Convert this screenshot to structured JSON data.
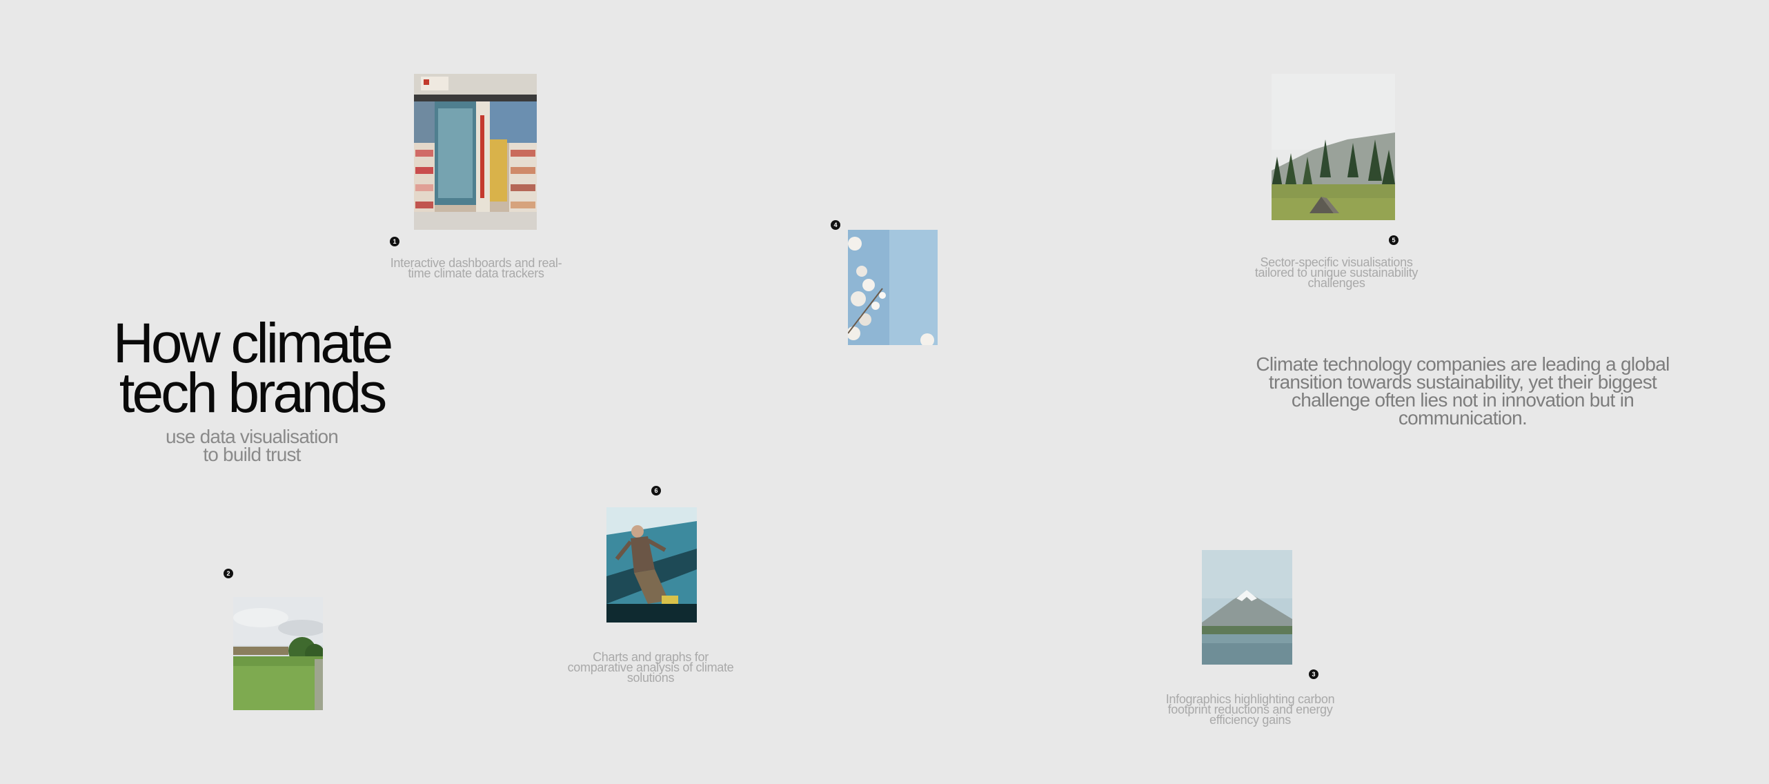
{
  "hero": {
    "title_line1": "How climate",
    "title_line2": "tech brands",
    "subtitle_line1": "use data visualisation",
    "subtitle_line2": "to build trust"
  },
  "intro": "Climate technology companies are leading a global transition towards sustainability, yet their biggest challenge often lies not in innovation but in communication.",
  "items": [
    {
      "number": "1",
      "caption_line1": "Interactive dashboards and real-",
      "caption_line2": "time climate data trackers",
      "image": "storefront-photo"
    },
    {
      "number": "2",
      "caption_line1": "",
      "caption_line2": "",
      "image": "meadow-photo"
    },
    {
      "number": "3",
      "caption_line1": "Infographics highlighting carbon",
      "caption_line2": "footprint reductions and energy",
      "caption_line3": "efficiency gains",
      "image": "mountain-lake-photo"
    },
    {
      "number": "4",
      "caption_line1": "",
      "caption_line2": "",
      "image": "blossom-sky-photo"
    },
    {
      "number": "5",
      "caption_line1": "Sector-specific visualisations",
      "caption_line2": "tailored to unique sustainability",
      "caption_line3": "challenges",
      "image": "forest-tent-photo"
    },
    {
      "number": "6",
      "caption_line1": "Charts and graphs for",
      "caption_line2": "comparative analysis of climate",
      "caption_line3": "solutions",
      "image": "skater-ramp-photo"
    }
  ]
}
